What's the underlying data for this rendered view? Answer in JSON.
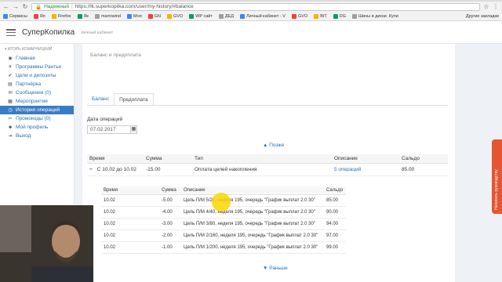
{
  "browser": {
    "secure_label": "Надежный",
    "url": "https://lk.superkopilka.com/user/my-history/#balance",
    "bookmarks": [
      "Сервисы",
      "Яп",
      "Firefox",
      "Як",
      "marniwind",
      "Моя",
      "GN",
      "GVO",
      "WP сайт",
      "ДЕД",
      "Личный кабинет - V",
      "GVO",
      "BIT",
      "DG",
      "Шины и диски. Купи"
    ],
    "other_bookmarks": "Другие закладки"
  },
  "app": {
    "brand": "СуперКопилка",
    "brand_sub": "личный кабинет",
    "user": "ИГОРЬ КОМАРНИЦКИЙ"
  },
  "sidebar": {
    "items": [
      {
        "label": "Главная",
        "icon": "map-marker-icon"
      },
      {
        "label": "Программы Рантье",
        "icon": "plane-icon"
      },
      {
        "label": "Цели и депозиты",
        "icon": "check-icon"
      },
      {
        "label": "Партнёрка",
        "icon": "chart-icon"
      },
      {
        "label": "Сообщения (0)",
        "icon": "envelope-icon"
      },
      {
        "label": "Мероприятия",
        "icon": "calendar-icon"
      },
      {
        "label": "История операций",
        "icon": "clock-icon"
      },
      {
        "label": "Промокоды (0)",
        "icon": "ticket-icon"
      },
      {
        "label": "Мой профиль",
        "icon": "user-icon"
      },
      {
        "label": "Выход",
        "icon": "exit-icon"
      }
    ],
    "active_index": 6
  },
  "main": {
    "panel_title": "Баланс и предоплата",
    "tabs": [
      "Баланс",
      "Предоплата"
    ],
    "date_label": "Дата операций",
    "date_value": "07.02.2017",
    "later_link": "▲ Позже",
    "earlier_link": "▼ Раньше",
    "table": {
      "headers": [
        "Время",
        "Сумма",
        "Тип",
        "Описание",
        "Сальдо"
      ],
      "row": {
        "toggle": "−",
        "time": "С 10.02 до 10.02",
        "sum": "-15.00",
        "type": "Оплата целей накопления",
        "desc": "5 операций",
        "balance": "85.00"
      }
    },
    "subtable": {
      "headers": [
        "Время",
        "Сумма",
        "Описание",
        "Сальдо"
      ],
      "rows": [
        {
          "time": "10.02",
          "sum": "-5.00",
          "desc": "Цель П/М 5/20, неделя 195, очередь \"График выплат 2.0 30\"",
          "balance": "85.00"
        },
        {
          "time": "10.02",
          "sum": "-4.00",
          "desc": "Цель П/М 4/40, неделя 195, очередь \"График выплат 2.0 30\"",
          "balance": "90.00"
        },
        {
          "time": "10.02",
          "sum": "-3.00",
          "desc": "Цель П/М 3/80, неделя 195, очередь \"График выплат 2.0 30\"",
          "balance": "94.00"
        },
        {
          "time": "10.02",
          "sum": "-2.00",
          "desc": "Цель П/М 2/160, неделя 195, очередь \"График выплат 2.0 30\"",
          "balance": "97.00"
        },
        {
          "time": "10.02",
          "sum": "-1.00",
          "desc": "Цель П/М 1/200, неделя 195, очередь \"График выплат 2.0 30\"",
          "balance": "99.00"
        }
      ]
    }
  },
  "side_tab": "Написать руководству",
  "colors": {
    "accent": "#3a7cc3",
    "link": "#2a6fb5",
    "side_tab": "#e55531",
    "cursor": "#fad700"
  }
}
